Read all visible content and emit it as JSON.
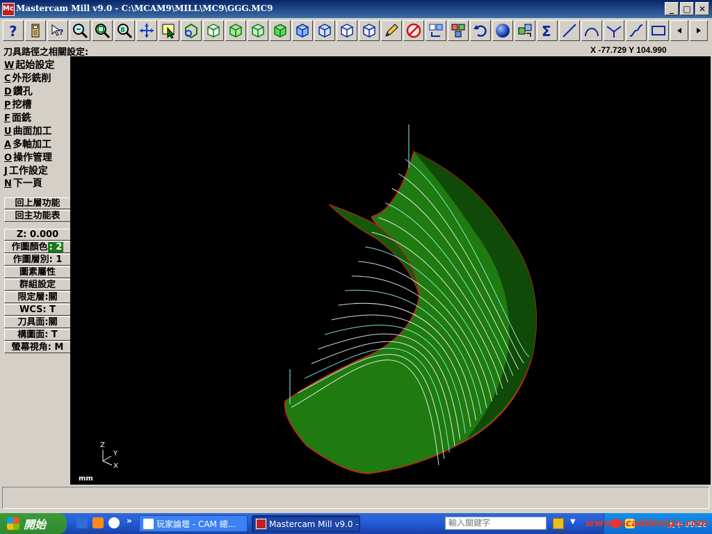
{
  "window": {
    "title": "Mastercam Mill v9.0 - C:\\MCAM9\\MILL\\MC9\\GGG.MC9",
    "app_icon_text": "Mc",
    "minimize": "_",
    "maximize": "□",
    "close": "✕"
  },
  "toolbar": {
    "buttons": [
      "help-icon",
      "calculator-icon",
      "whats-this-icon",
      "zoom-window-icon",
      "zoom-fit-icon",
      "zoom-scale-icon",
      "pan-icon",
      "select-icon",
      "hide-icon",
      "view-top-icon",
      "view-front-icon",
      "view-side-icon",
      "view-iso-icon",
      "cube-top-icon",
      "cube-front-icon",
      "cube-side-icon",
      "cube-iso-icon",
      "pencil-icon",
      "delete-icon",
      "move-icon",
      "copy-icon",
      "undo-icon",
      "shade-sphere-icon",
      "group-icon",
      "sigma-icon",
      "line-icon",
      "arc-icon",
      "fillet-icon",
      "spline-icon",
      "rectangle-icon",
      "prev-page-icon",
      "next-page-icon"
    ]
  },
  "prompt": "刀具路徑之相關設定:",
  "coords": "X -77.729  Y 104.990",
  "menu": {
    "items": [
      {
        "key": "W",
        "label": "起始設定"
      },
      {
        "key": "C",
        "label": "外形銑削"
      },
      {
        "key": "D",
        "label": "鑽孔"
      },
      {
        "key": "P",
        "label": "挖槽"
      },
      {
        "key": "F",
        "label": "面銑"
      },
      {
        "key": "U",
        "label": "曲面加工"
      },
      {
        "key": "A",
        "label": "多軸加工"
      },
      {
        "key": "O",
        "label": "操作管理"
      },
      {
        "key": "J",
        "label": "工作設定"
      },
      {
        "key": "N",
        "label": "下一頁"
      }
    ],
    "back": "回上層功能",
    "main": "回主功能表"
  },
  "settings": {
    "z": "Z:  0.000",
    "color_label": "作圖顏色",
    "color_value": ": 2",
    "level": "作圖層別: 1",
    "attributes": "圖素屬性",
    "group": "群組設定",
    "mask": "限定層:關",
    "wcs": "WCS:  T",
    "tool_plane": "刀具面:關",
    "cplane": "構圖面: T",
    "gview": "螢幕視角: M"
  },
  "viewport": {
    "units": "mm",
    "axis_z": "Z",
    "axis_y": "Y",
    "axis_x": "X",
    "background": "#000000",
    "surface_color": "#1f7a10",
    "toolpath_color": "#ffffff",
    "edge_color": "#d02020"
  },
  "taskbar": {
    "start": "開始",
    "chevron": "»",
    "tasks": [
      "玩家論壇 - CAM 總...",
      "Mastercam Mill v9.0 - ..."
    ],
    "search_placeholder": "輸入關鍵字",
    "clock": "上午 09:26"
  },
  "watermark": "www.mcaddesign.com"
}
